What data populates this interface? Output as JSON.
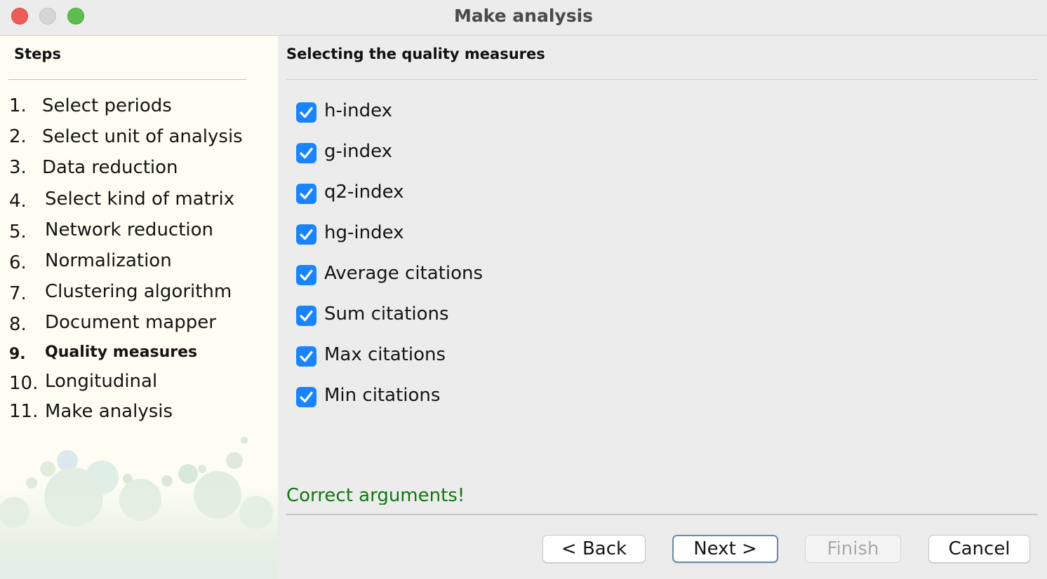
{
  "window": {
    "title": "Make analysis"
  },
  "steps": {
    "heading": "Steps",
    "current_index": 8,
    "items": [
      {
        "num": "1.",
        "label": "Select periods"
      },
      {
        "num": "2.",
        "label": "Select unit of analysis"
      },
      {
        "num": "3.",
        "label": "Data reduction"
      },
      {
        "num": "4.",
        "label": "Select kind of matrix"
      },
      {
        "num": "5.",
        "label": "Network reduction"
      },
      {
        "num": "6.",
        "label": "Normalization"
      },
      {
        "num": "7.",
        "label": "Clustering algorithm"
      },
      {
        "num": "8.",
        "label": "Document mapper"
      },
      {
        "num": "9.",
        "label": "Quality measures"
      },
      {
        "num": "10.",
        "label": "Longitudinal"
      },
      {
        "num": "11.",
        "label": "Make analysis"
      }
    ]
  },
  "content": {
    "heading": "Selecting the quality measures",
    "measures": [
      {
        "label": "h-index",
        "checked": true
      },
      {
        "label": "g-index",
        "checked": true
      },
      {
        "label": "q2-index",
        "checked": true
      },
      {
        "label": "hg-index",
        "checked": true
      },
      {
        "label": "Average citations",
        "checked": true
      },
      {
        "label": "Sum citations",
        "checked": true
      },
      {
        "label": "Max citations",
        "checked": true
      },
      {
        "label": "Min citations",
        "checked": true
      }
    ],
    "status": "Correct arguments!"
  },
  "buttons": {
    "back": "< Back",
    "next": "Next >",
    "finish": "Finish",
    "cancel": "Cancel"
  },
  "colors": {
    "checkbox": "#1a84ff",
    "status_text": "#117711",
    "panel_bg": "#fdfdf4"
  }
}
